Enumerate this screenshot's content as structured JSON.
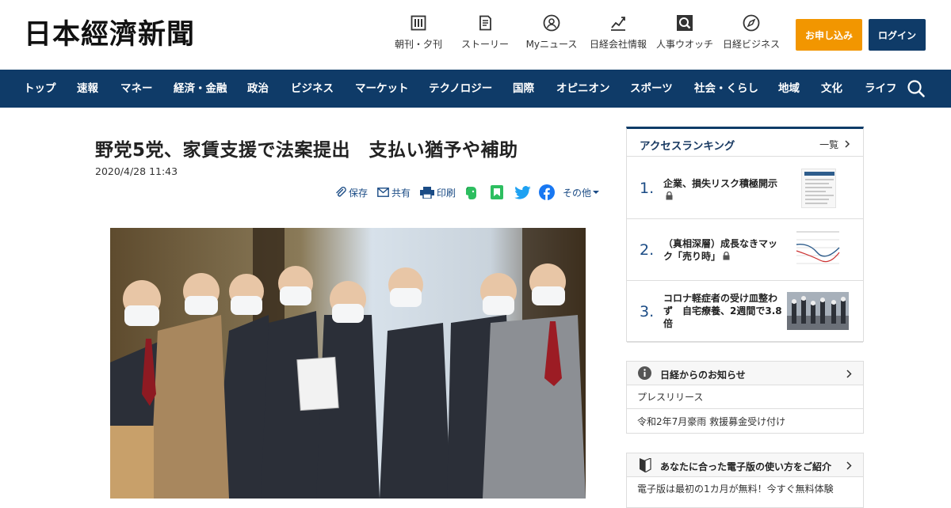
{
  "header": {
    "logo_text": "日本經濟新聞",
    "utility_links": [
      {
        "label": "朝刊・夕刊",
        "icon": "newspaper-icon"
      },
      {
        "label": "ストーリー",
        "icon": "book-icon"
      },
      {
        "label": "Myニュース",
        "icon": "user-circle-icon"
      },
      {
        "label": "日経会社情報",
        "icon": "chart-line-icon"
      },
      {
        "label": "人事ウオッチ",
        "icon": "magnifier-icon"
      },
      {
        "label": "日経ビジネス",
        "icon": "compass-icon"
      }
    ],
    "apply_label": "お申し込み",
    "login_label": "ログイン"
  },
  "nav": {
    "items": [
      "トップ",
      "速報",
      "マネー",
      "経済・金融",
      "政治",
      "ビジネス",
      "マーケット",
      "テクノロジー",
      "国際",
      "オピニオン",
      "スポーツ",
      "社会・くらし",
      "地域",
      "文化",
      "ライフ"
    ]
  },
  "article": {
    "title": "野党5党、家賃支援で法案提出　支払い猶予や補助",
    "date": "2020/4/28 11:43",
    "share": {
      "save": "保存",
      "share": "共有",
      "print": "印刷",
      "more": "その他"
    }
  },
  "ranking": {
    "title": "アクセスランキング",
    "more": "一覧",
    "items": [
      {
        "rank": "1.",
        "text": "企業、損失リスク積極開示"
      },
      {
        "rank": "2.",
        "text": "（真相深層）成長なきマック「売り時」"
      },
      {
        "rank": "3.",
        "text": "コロナ軽症者の受け皿整わず　自宅療養、2週間で3.8倍"
      }
    ]
  },
  "notices": {
    "title": "日経からのお知らせ",
    "items": [
      "プレスリリース",
      "令和2年7月豪雨 救援募金受け付け"
    ]
  },
  "guide": {
    "title": "あなたに合った電子版の使い方をご紹介",
    "text": "電子版は最初の1カ月が無料！今すぐ無料体験"
  },
  "colors": {
    "navy": "#0f3b68",
    "orange": "#f29600",
    "link_blue": "#1a4b85",
    "evernote_green": "#2dbe60",
    "twitter_blue": "#1da1f2",
    "facebook_blue": "#1877f2"
  }
}
